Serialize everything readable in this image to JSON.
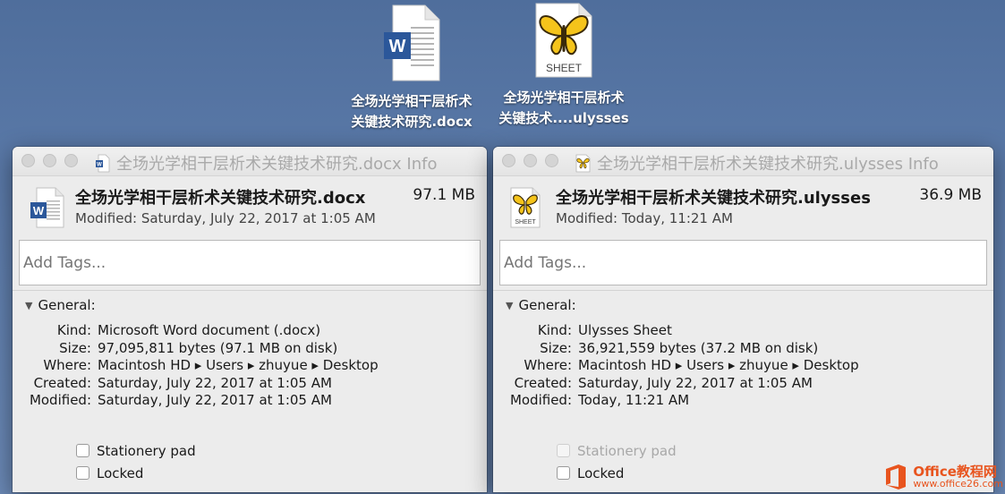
{
  "desktop": {
    "docx_label_line1": "全场光学相干层析术",
    "docx_label_line2": "关键技术研究.docx",
    "ulysses_label_line1": "全场光学相干层析术",
    "ulysses_label_line2": "关键技术....ulysses",
    "sheet_badge": "SHEET"
  },
  "windows": [
    {
      "title": "全场光学相干层析术关键技术研究.docx Info",
      "name": "全场光学相干层析术关键技术研究.docx",
      "size": "97.1 MB",
      "modified": "Modified: Saturday, July 22, 2017 at 1:05 AM",
      "tags_placeholder": "Add Tags...",
      "general_label": "General:",
      "info": [
        {
          "key": "Kind:",
          "value": "Microsoft Word document (.docx)"
        },
        {
          "key": "Size:",
          "value": "97,095,811 bytes (97.1 MB on disk)"
        },
        {
          "key": "Where:",
          "value": "Macintosh HD ▸ Users ▸ zhuyue ▸ Desktop"
        },
        {
          "key": "Created:",
          "value": "Saturday, July 22, 2017 at 1:05 AM"
        },
        {
          "key": "Modified:",
          "value": "Saturday, July 22, 2017 at 1:05 AM"
        }
      ],
      "stationery_label": "Stationery pad",
      "locked_label": "Locked",
      "icon": "word-doc-icon"
    },
    {
      "title": "全场光学相干层析术关键技术研究.ulysses Info",
      "name": "全场光学相干层析术关键技术研究.ulysses",
      "size": "36.9 MB",
      "modified": "Modified: Today, 11:21 AM",
      "tags_placeholder": "Add Tags...",
      "general_label": "General:",
      "info": [
        {
          "key": "Kind:",
          "value": "Ulysses Sheet"
        },
        {
          "key": "Size:",
          "value": "36,921,559 bytes (37.2 MB on disk)"
        },
        {
          "key": "Where:",
          "value": "Macintosh HD ▸ Users ▸ zhuyue ▸ Desktop"
        },
        {
          "key": "Created:",
          "value": "Saturday, July 22, 2017 at 1:05 AM"
        },
        {
          "key": "Modified:",
          "value": "Today, 11:21 AM"
        }
      ],
      "stationery_label": "Stationery pad",
      "locked_label": "Locked",
      "icon": "ulysses-sheet-icon"
    }
  ],
  "watermark": {
    "line1": "Office教程网",
    "line2": "www.office26.com"
  },
  "colors": {
    "desktop_bg": "#5d7cab",
    "word_blue": "#2b579a",
    "butterfly_yellow": "#f5c41b",
    "watermark_orange": "#e8541e"
  }
}
